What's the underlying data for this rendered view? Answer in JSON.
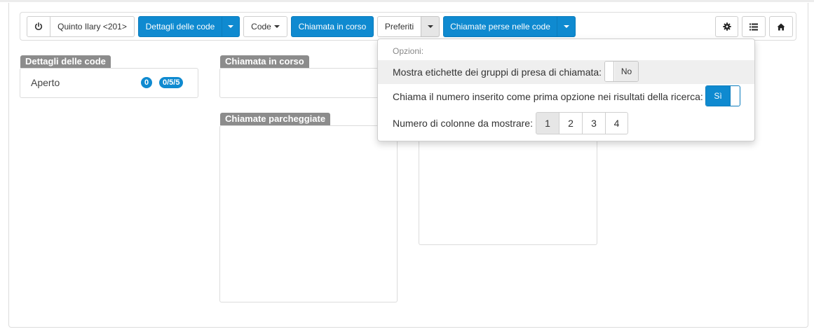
{
  "toolbar": {
    "user_label": "Quinto Ilary <201>",
    "queue_details_label": "Dettagli delle code",
    "queues_label": "Code",
    "calls_in_progress_label": "Chiamata in corso",
    "favorites_label": "Preferiti",
    "missed_calls_label": "Chiamate perse nelle code"
  },
  "panels": {
    "queue_details": {
      "title": "Dettagli delle code",
      "queues": [
        {
          "name": "Aperto",
          "waiting": "0",
          "stats": "0/5/5"
        }
      ]
    },
    "call_in_progress": {
      "title": "Chiamata in corso"
    },
    "parked_calls": {
      "title": "Chiamate parcheggiate"
    }
  },
  "options_menu": {
    "header": "Opzioni:",
    "rows": [
      {
        "label": "Mostra etichette dei gruppi di presa di chiamata:",
        "toggle_value": "No",
        "toggle_on": false
      },
      {
        "label": "Chiama il numero inserito come prima opzione nei risultati della ricerca:",
        "toggle_value": "Sì",
        "toggle_on": true
      }
    ],
    "columns_label": "Numero di colonne da mostrare:",
    "column_options": [
      "1",
      "2",
      "3",
      "4"
    ],
    "column_selected": "1"
  },
  "colors": {
    "primary": "#0f8ad0",
    "panel_label": "#8c8c8c",
    "highlight_row": "#efefef"
  }
}
